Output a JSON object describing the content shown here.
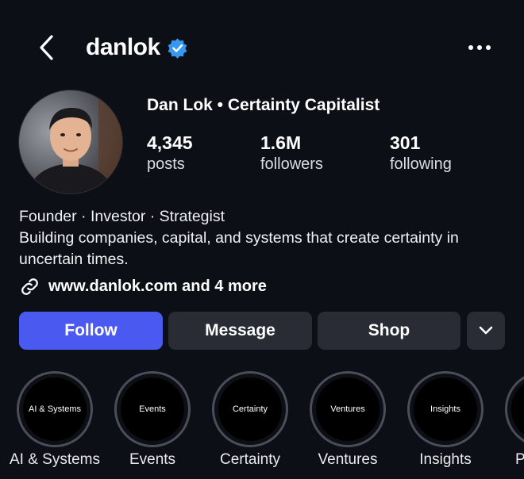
{
  "header": {
    "username": "danlok",
    "icons": {
      "back": "chevron-left-icon",
      "verified": "verified-badge-icon",
      "more": "more-horizontal-icon"
    },
    "accent_verified": "#3897f0"
  },
  "profile": {
    "display_name": "Dan Lok • Certainty Capitalist",
    "stats": {
      "posts": {
        "value": "4,345",
        "label": "posts"
      },
      "followers": {
        "value": "1.6M",
        "label": "followers"
      },
      "following": {
        "value": "301",
        "label": "following"
      }
    },
    "bio": {
      "line1": "Founder · Investor · Strategist",
      "line2": "Building companies, capital, and systems that create certainty in uncertain times."
    },
    "link": {
      "text": "www.danlok.com and 4 more",
      "icon": "link-icon"
    }
  },
  "actions": {
    "follow": "Follow",
    "message": "Message",
    "shop": "Shop",
    "dropdown_icon": "chevron-down-icon",
    "primary_color": "#4a5af0"
  },
  "highlights": [
    {
      "inner": "AI & Systems",
      "label": "AI & Systems"
    },
    {
      "inner": "Events",
      "label": "Events"
    },
    {
      "inner": "Certainty",
      "label": "Certainty"
    },
    {
      "inner": "Ventures",
      "label": "Ventures"
    },
    {
      "inner": "Insights",
      "label": "Insights"
    },
    {
      "inner": "",
      "label": "P"
    }
  ]
}
